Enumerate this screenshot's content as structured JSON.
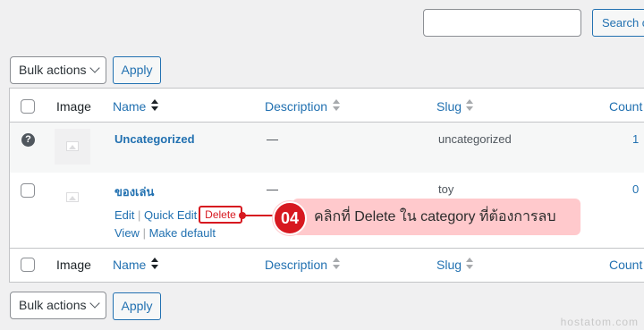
{
  "search": {
    "button_label": "Search c"
  },
  "bulk_top": {
    "select_value": "Bulk actions",
    "apply_label": "Apply"
  },
  "bulk_bottom": {
    "select_value": "Bulk actions",
    "apply_label": "Apply"
  },
  "table": {
    "headers": {
      "image": "Image",
      "name": "Name",
      "description": "Description",
      "slug": "Slug",
      "count": "Count"
    },
    "rows": [
      {
        "name": "Uncategorized",
        "description": "—",
        "slug": "uncategorized",
        "count": "1"
      },
      {
        "name": "ของเล่น",
        "description": "—",
        "slug": "toy",
        "count": "0",
        "actions": {
          "edit": "Edit",
          "quick_edit": "Quick Edit",
          "delete": "Delete",
          "view": "View",
          "make_default": "Make default"
        }
      }
    ]
  },
  "callout": {
    "number": "04",
    "text": "คลิกที่ Delete ใน category ที่ต้องการลบ",
    "color": "#d71920"
  },
  "watermark": "hostatom.com",
  "icons": {
    "help": "question-circle-icon",
    "thumb": "image-placeholder-icon",
    "sort": "sort-arrows-icon",
    "chevron": "chevron-down-icon"
  }
}
